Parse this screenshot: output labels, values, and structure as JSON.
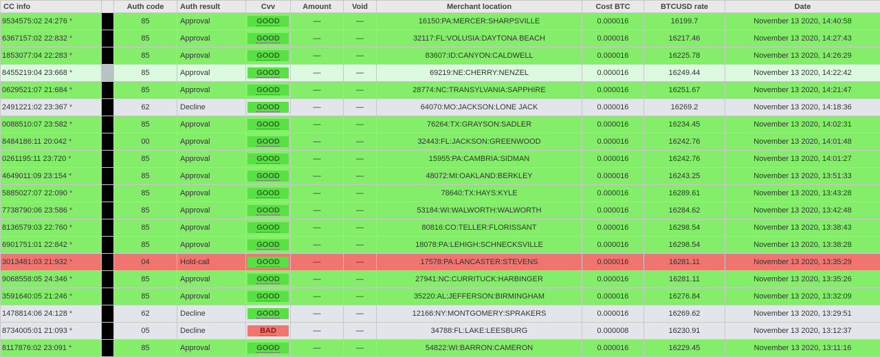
{
  "columns": {
    "cc_info": "CC info",
    "auth_code": "Auth code",
    "auth_result": "Auth result",
    "cvv": "Cvv",
    "amount": "Amount",
    "void": "Void",
    "merchant_location": "Merchant location",
    "cost_btc": "Cost BTC",
    "btcusd_rate": "BTCUSD rate",
    "date": "Date"
  },
  "star": "*",
  "rows": [
    {
      "cc": "9534575:02 24:276",
      "code": "85",
      "result": "Approval",
      "cvv": "GOOD",
      "amount": "—",
      "void": "—",
      "location": "16150:PA:MERCER:SHARPSVILLE",
      "cost": "0.000016",
      "rate": "16199.7",
      "date": "November 13 2020, 14:40:58",
      "status": "approval"
    },
    {
      "cc": "6367157:02 22:832",
      "code": "85",
      "result": "Approval",
      "cvv": "GOOD",
      "amount": "—",
      "void": "—",
      "location": "32117:FL:VOLUSIA:DAYTONA BEACH",
      "cost": "0.000016",
      "rate": "16217.46",
      "date": "November 13 2020, 14:27:43",
      "status": "approval"
    },
    {
      "cc": "1853077:04 22:283",
      "code": "85",
      "result": "Approval",
      "cvv": "GOOD",
      "amount": "—",
      "void": "—",
      "location": "83607:ID:CANYON:CALDWELL",
      "cost": "0.000016",
      "rate": "16225.78",
      "date": "November 13 2020, 14:26:29",
      "status": "approval"
    },
    {
      "cc": "8455219:04 23:668",
      "code": "85",
      "result": "Approval",
      "cvv": "GOOD",
      "amount": "—",
      "void": "—",
      "location": "69219:NE:CHERRY:NENZEL",
      "cost": "0.000016",
      "rate": "16249.44",
      "date": "November 13 2020, 14:22:42",
      "status": "highlight"
    },
    {
      "cc": "0629521:07 21:684",
      "code": "85",
      "result": "Approval",
      "cvv": "GOOD",
      "amount": "—",
      "void": "—",
      "location": "28774:NC:TRANSYLVANIA:SAPPHIRE",
      "cost": "0.000016",
      "rate": "16251.67",
      "date": "November 13 2020, 14:21:47",
      "status": "approval"
    },
    {
      "cc": "2491221:02 23:367",
      "code": "62",
      "result": "Decline",
      "cvv": "GOOD",
      "amount": "—",
      "void": "—",
      "location": "64070:MO:JACKSON:LONE JACK",
      "cost": "0.000016",
      "rate": "16269.2",
      "date": "November 13 2020, 14:18:36",
      "status": "decline"
    },
    {
      "cc": "0088510:07 23:582",
      "code": "85",
      "result": "Approval",
      "cvv": "GOOD",
      "amount": "—",
      "void": "—",
      "location": "76264:TX:GRAYSON:SADLER",
      "cost": "0.000016",
      "rate": "16234.45",
      "date": "November 13 2020, 14:02:31",
      "status": "approval"
    },
    {
      "cc": "8484186:11 20:042",
      "code": "00",
      "result": "Approval",
      "cvv": "GOOD",
      "amount": "—",
      "void": "—",
      "location": "32443:FL:JACKSON:GREENWOOD",
      "cost": "0.000016",
      "rate": "16242.76",
      "date": "November 13 2020, 14:01:48",
      "status": "approval"
    },
    {
      "cc": "0261195:11 23:720",
      "code": "85",
      "result": "Approval",
      "cvv": "GOOD",
      "amount": "—",
      "void": "—",
      "location": "15955:PA:CAMBRIA:SIDMAN",
      "cost": "0.000016",
      "rate": "16242.76",
      "date": "November 13 2020, 14:01:27",
      "status": "approval"
    },
    {
      "cc": "4649011:09 23:154",
      "code": "85",
      "result": "Approval",
      "cvv": "GOOD",
      "amount": "—",
      "void": "—",
      "location": "48072:MI:OAKLAND:BERKLEY",
      "cost": "0.000016",
      "rate": "16243.25",
      "date": "November 13 2020, 13:51:33",
      "status": "approval"
    },
    {
      "cc": "5885027:07 22:090",
      "code": "85",
      "result": "Approval",
      "cvv": "GOOD",
      "amount": "—",
      "void": "—",
      "location": "78640:TX:HAYS:KYLE",
      "cost": "0.000016",
      "rate": "16289.61",
      "date": "November 13 2020, 13:43:28",
      "status": "approval"
    },
    {
      "cc": "7738790:06 23:586",
      "code": "85",
      "result": "Approval",
      "cvv": "GOOD",
      "amount": "—",
      "void": "—",
      "location": "53184:WI:WALWORTH:WALWORTH",
      "cost": "0.000016",
      "rate": "16284.62",
      "date": "November 13 2020, 13:42:48",
      "status": "approval"
    },
    {
      "cc": "8136579:03 22:760",
      "code": "85",
      "result": "Approval",
      "cvv": "GOOD",
      "amount": "—",
      "void": "—",
      "location": "80816:CO:TELLER:FLORISSANT",
      "cost": "0.000016",
      "rate": "16298.54",
      "date": "November 13 2020, 13:38:43",
      "status": "approval"
    },
    {
      "cc": "6901751:01 22:842",
      "code": "85",
      "result": "Approval",
      "cvv": "GOOD",
      "amount": "—",
      "void": "—",
      "location": "18078:PA:LEHIGH:SCHNECKSVILLE",
      "cost": "0.000016",
      "rate": "16298.54",
      "date": "November 13 2020, 13:38:28",
      "status": "approval"
    },
    {
      "cc": "3013481:03 21:932",
      "code": "04",
      "result": "Hold-call",
      "cvv": "GOOD",
      "amount": "—",
      "void": "—",
      "location": "17578:PA:LANCASTER:STEVENS",
      "cost": "0.000016",
      "rate": "16281.11",
      "date": "November 13 2020, 13:35:29",
      "status": "holdcall"
    },
    {
      "cc": "9068558:05 24:346",
      "code": "85",
      "result": "Approval",
      "cvv": "GOOD",
      "amount": "—",
      "void": "—",
      "location": "27941:NC:CURRITUCK:HARBINGER",
      "cost": "0.000016",
      "rate": "16281.11",
      "date": "November 13 2020, 13:35:26",
      "status": "approval"
    },
    {
      "cc": "3591640:05 21:246",
      "code": "85",
      "result": "Approval",
      "cvv": "GOOD",
      "amount": "—",
      "void": "—",
      "location": "35220:AL:JEFFERSON:BIRMINGHAM",
      "cost": "0.000016",
      "rate": "16276.84",
      "date": "November 13 2020, 13:32:09",
      "status": "approval"
    },
    {
      "cc": "1478814:06 24:128",
      "code": "62",
      "result": "Decline",
      "cvv": "GOOD",
      "amount": "—",
      "void": "—",
      "location": "12166:NY:MONTGOMERY:SPRAKERS",
      "cost": "0.000016",
      "rate": "16269.62",
      "date": "November 13 2020, 13:29:51",
      "status": "decline"
    },
    {
      "cc": "8734005:01 21:093",
      "code": "05",
      "result": "Decline",
      "cvv": "BAD",
      "amount": "—",
      "void": "—",
      "location": "34788:FL:LAKE:LEESBURG",
      "cost": "0.000008",
      "rate": "16230.91",
      "date": "November 13 2020, 13:12:37",
      "status": "decline"
    },
    {
      "cc": "8117876:02 23:091",
      "code": "85",
      "result": "Approval",
      "cvv": "GOOD",
      "amount": "—",
      "void": "—",
      "location": "54822:WI:BARRON:CAMERON",
      "cost": "0.000016",
      "rate": "16229.45",
      "date": "November 13 2020, 13:11:16",
      "status": "approval"
    }
  ],
  "colors": {
    "approval": "#84ee6a",
    "decline": "#e2e6ea",
    "holdcall": "#f07470",
    "highlight": "#dcfae0",
    "cvv_good": "#58e044",
    "cvv_bad": "#f07470"
  }
}
